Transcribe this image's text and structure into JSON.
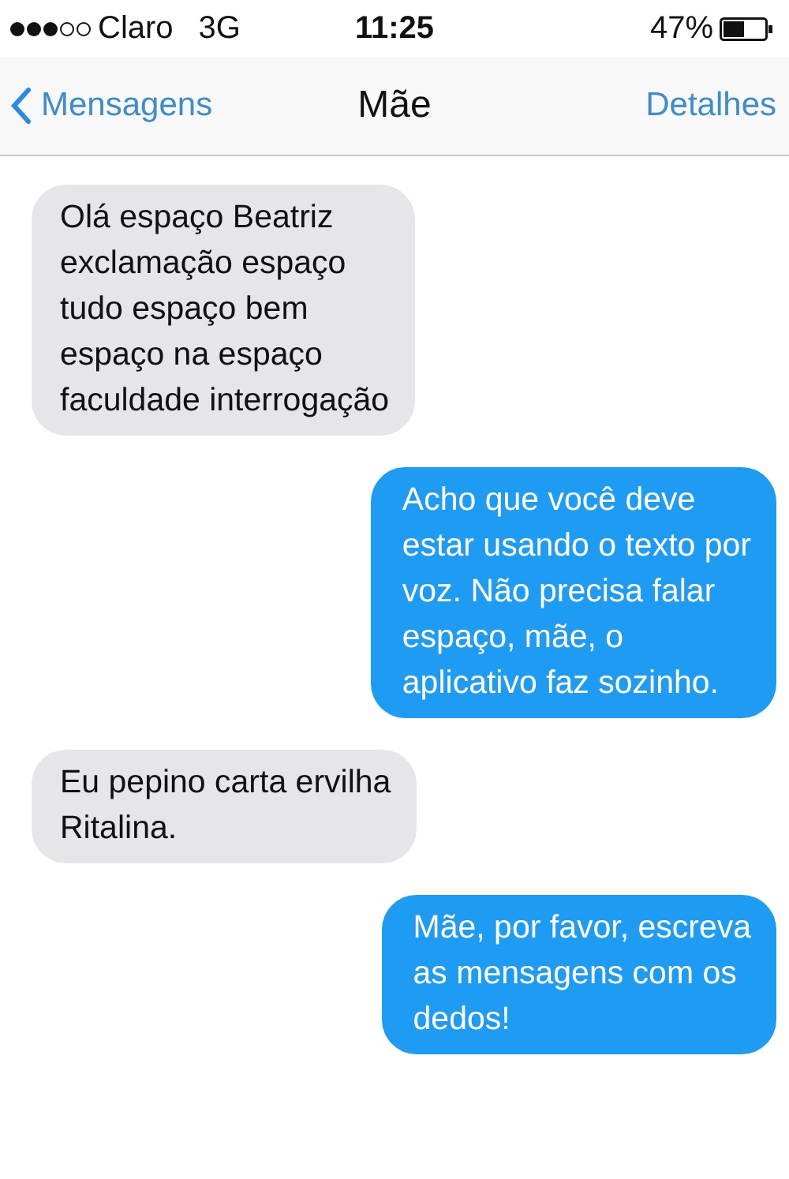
{
  "status_bar": {
    "carrier": "Claro",
    "network": "3G",
    "time": "11:25",
    "battery": "47%"
  },
  "nav_bar": {
    "back": "Mensagens",
    "title": "Mãe",
    "action": "Detalhes"
  },
  "messages": [
    {
      "kind": "incoming",
      "text": "Olá espaço Beatriz\nexclamação espaço\ntudo espaço bem\nespaço na espaço\nfaculdade interrogação"
    },
    {
      "kind": "outgoing",
      "text": "Acho que você deve\nestar usando o texto por\nvoz. Não precisa falar\nespaço, mãe, o\naplicativo faz sozinho."
    },
    {
      "kind": "incoming",
      "text": "Eu pepino carta ervilha\nRitalina."
    },
    {
      "kind": "outgoing",
      "text": "Mãe, por favor, escreva\nas mensagens com os\ndedos!"
    }
  ]
}
